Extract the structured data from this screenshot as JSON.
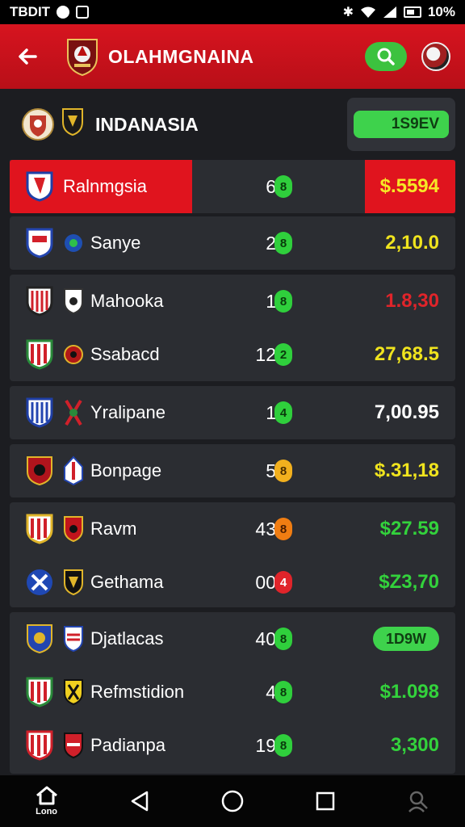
{
  "status_bar": {
    "left_text": "TBDIT",
    "battery": "10%",
    "icons": [
      "notification-icon",
      "gallery-icon",
      "bluetooth-icon",
      "wifi-icon",
      "signal-icon",
      "battery-icon"
    ]
  },
  "app_bar": {
    "title": "OLAHMGNAINA",
    "back_icon": "arrow-left-icon",
    "search_icon": "search-icon"
  },
  "league": {
    "name": "INDANASIA",
    "button_label": "1S9EV"
  },
  "colors": {
    "brand_red": "#d7141f",
    "accent_green": "#3ed24c",
    "price_yellow": "#f0e41e",
    "price_red": "#e0242a",
    "price_green": "#33d23c",
    "price_white": "#ffffff",
    "badge_orange": "#f07d12"
  },
  "rows": [
    {
      "team": "Ralnmgsia",
      "num": "6",
      "badge": "8",
      "price": "$.5594"
    },
    {
      "team": "Sanye",
      "num": "2",
      "badge": "8",
      "price": "2,10.0"
    },
    {
      "team": "Mahooka",
      "num": "1",
      "badge": "8",
      "price": "1.8,30"
    },
    {
      "team": "Ssabacd",
      "num": "12",
      "badge": "2",
      "price": "27,68.5"
    },
    {
      "team": "Yralipane",
      "num": "1",
      "badge": "4",
      "price": "7,00.95"
    },
    {
      "team": "Bonpage",
      "num": "5",
      "badge": "8",
      "price": "$.31,18"
    },
    {
      "team": "Ravm",
      "num": "43",
      "badge": "8",
      "price": "$27.59"
    },
    {
      "team": "Gethama",
      "num": "00",
      "badge": "4",
      "price": "$Z3,70"
    },
    {
      "team": "Djatlacas",
      "num": "40",
      "badge": "8",
      "price": "1D9W"
    },
    {
      "team": "Refmstidion",
      "num": "4",
      "badge": "8",
      "price": "$1.098"
    },
    {
      "team": "Padianpa",
      "num": "19",
      "badge": "8",
      "price": "3,300"
    }
  ],
  "nav": {
    "home_label": "Lono",
    "items": [
      "home-icon",
      "back-triangle-icon",
      "home-circle-icon",
      "recents-square-icon",
      "search-person-icon"
    ]
  }
}
